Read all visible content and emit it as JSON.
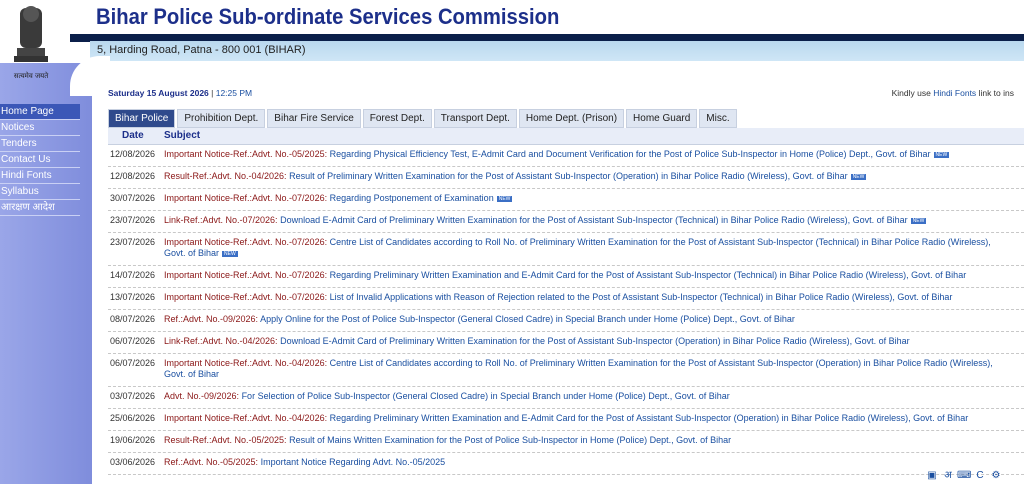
{
  "header": {
    "title": "Bihar Police Sub-ordinate Services Commission",
    "address": "5, Harding Road, Patna - 800 001 (BIHAR)",
    "emblem_caption": "सत्यमेव जयते"
  },
  "sidebar": {
    "items": [
      {
        "label": "Home Page"
      },
      {
        "label": "Notices"
      },
      {
        "label": "Tenders"
      },
      {
        "label": "Contact Us"
      },
      {
        "label": "Hindi Fonts"
      },
      {
        "label": "Syllabus"
      },
      {
        "label": "आरक्षण आदेश"
      }
    ]
  },
  "dateline": {
    "date": "Saturday 15 August 2026",
    "time": "12:25 PM"
  },
  "hindi_note": {
    "prefix": "Kindly use",
    "link": "Hindi Fonts",
    "suffix": "link to ins"
  },
  "tabs": [
    {
      "label": "Bihar Police"
    },
    {
      "label": "Prohibition Dept."
    },
    {
      "label": "Bihar Fire Service"
    },
    {
      "label": "Forest Dept."
    },
    {
      "label": "Transport Dept."
    },
    {
      "label": "Home Dept. (Prison)"
    },
    {
      "label": "Home Guard"
    },
    {
      "label": "Misc."
    }
  ],
  "table": {
    "headers": {
      "date": "Date",
      "subject": "Subject"
    },
    "rows": [
      {
        "date": "12/08/2026",
        "ref": "Important Notice-Ref.:Advt. No.-05/2025:",
        "text": "Regarding Physical Efficiency Test, E-Admit Card and Document Verification for the Post of Police Sub-Inspector in Home (Police) Dept., Govt. of Bihar",
        "new": true
      },
      {
        "date": "12/08/2026",
        "ref": "Result-Ref.:Advt. No.-04/2026:",
        "text": "Result of Preliminary Written Examination for the Post of Assistant Sub-Inspector (Operation) in Bihar Police Radio (Wireless), Govt. of Bihar",
        "new": true
      },
      {
        "date": "30/07/2026",
        "ref": "Important Notice-Ref.:Advt. No.-07/2026:",
        "text": "Regarding Postponement of Examination",
        "new": true
      },
      {
        "date": "23/07/2026",
        "ref": "Link-Ref.:Advt. No.-07/2026:",
        "text": "Download E-Admit Card of Preliminary Written Examination for the Post of Assistant Sub-Inspector (Technical) in Bihar Police Radio (Wireless), Govt. of Bihar",
        "new": true
      },
      {
        "date": "23/07/2026",
        "ref": "Important Notice-Ref.:Advt. No.-07/2026:",
        "text": "Centre List of Candidates according to Roll No. of Preliminary Written Examination for the Post of Assistant Sub-Inspector (Technical) in Bihar Police Radio (Wireless), Govt. of Bihar",
        "new": true
      },
      {
        "date": "14/07/2026",
        "ref": "Important Notice-Ref.:Advt. No.-07/2026:",
        "text": "Regarding Preliminary Written Examination and E-Admit Card for the Post of Assistant Sub-Inspector (Technical) in Bihar Police Radio (Wireless), Govt. of Bihar",
        "new": false
      },
      {
        "date": "13/07/2026",
        "ref": "Important Notice-Ref.:Advt. No.-07/2026:",
        "text": "List of Invalid Applications with Reason of Rejection related to the Post of Assistant Sub-Inspector (Technical) in Bihar Police Radio (Wireless), Govt. of Bihar",
        "new": false
      },
      {
        "date": "08/07/2026",
        "ref": "Ref.:Advt. No.-09/2026:",
        "text": "Apply Online for the Post of Police Sub-Inspector (General Closed Cadre) in Special Branch under Home (Police) Dept., Govt. of Bihar",
        "new": false
      },
      {
        "date": "06/07/2026",
        "ref": "Link-Ref.:Advt. No.-04/2026:",
        "text": "Download E-Admit Card of Preliminary Written Examination for the Post of Assistant Sub-Inspector (Operation) in Bihar Police Radio (Wireless), Govt. of Bihar",
        "new": false
      },
      {
        "date": "06/07/2026",
        "ref": "Important Notice-Ref.:Advt. No.-04/2026:",
        "text": "Centre List of Candidates according to Roll No. of Preliminary Written Examination for the Post of Assistant Sub-Inspector (Operation) in Bihar Police Radio (Wireless), Govt. of Bihar",
        "new": false
      },
      {
        "date": "03/07/2026",
        "ref": "Advt. No.-09/2026:",
        "text": "For Selection of Police Sub-Inspector (General Closed Cadre) in Special Branch under Home (Police) Dept., Govt. of Bihar",
        "new": false
      },
      {
        "date": "25/06/2026",
        "ref": "Important Notice-Ref.:Advt. No.-04/2026:",
        "text": "Regarding Preliminary Written Examination and E-Admit Card for the Post of Assistant Sub-Inspector (Operation) in Bihar Police Radio (Wireless), Govt. of Bihar",
        "new": false
      },
      {
        "date": "19/06/2026",
        "ref": "Result-Ref.:Advt. No.-05/2025:",
        "text": "Result of Mains Written Examination for the Post of Police Sub-Inspector in Home (Police) Dept., Govt. of Bihar",
        "new": false
      },
      {
        "date": "03/06/2026",
        "ref": "Ref.:Advt. No.-05/2025:",
        "text": "Important Notice Regarding Advt. No.-05/2025",
        "new": false
      }
    ],
    "new_badge": "NEW"
  },
  "bottom_toolbar": {
    "hindi_char": "अ",
    "c_char": "C"
  },
  "colors": {
    "accent": "#1c2f8a",
    "sidebar": "#8a97e0",
    "ref": "#8a1616",
    "link": "#1a4fa0"
  }
}
